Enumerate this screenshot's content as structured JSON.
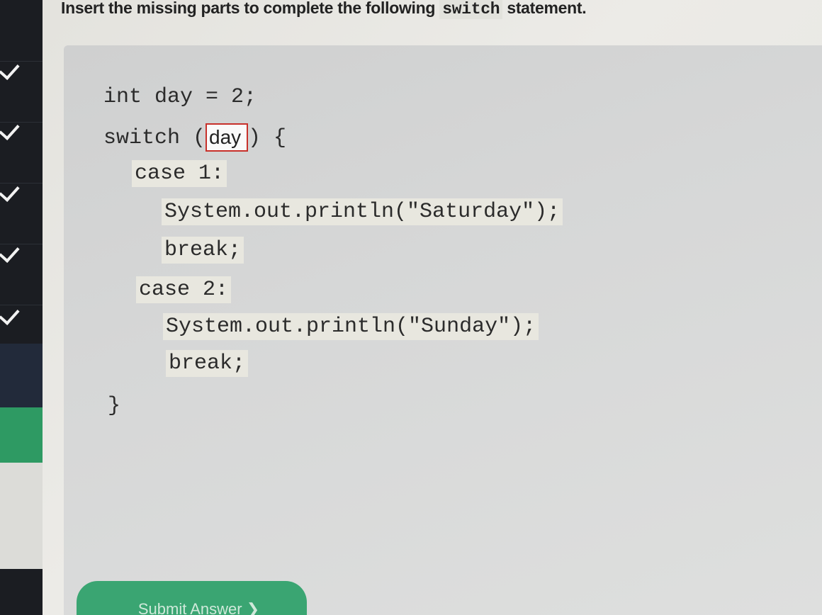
{
  "instruction": {
    "before": "Insert the missing parts to complete the following ",
    "keyword": "switch",
    "after": " statement."
  },
  "code": {
    "line1": "int day = 2;",
    "switch_kw": "switch (",
    "blank_value": "day",
    "switch_end": ") {",
    "case1": "case 1:",
    "println1": "System.out.println(\"Saturday\");",
    "break1": "break;",
    "case2": "case 2:",
    "println2": "System.out.println(\"Sunday\");",
    "break2": "break;",
    "close": "}"
  },
  "submit": {
    "label": "Submit Answer ❯"
  },
  "colors": {
    "accent_green": "#3aa572",
    "blank_border": "#c7302a",
    "sidebar": "#1b1d22"
  }
}
